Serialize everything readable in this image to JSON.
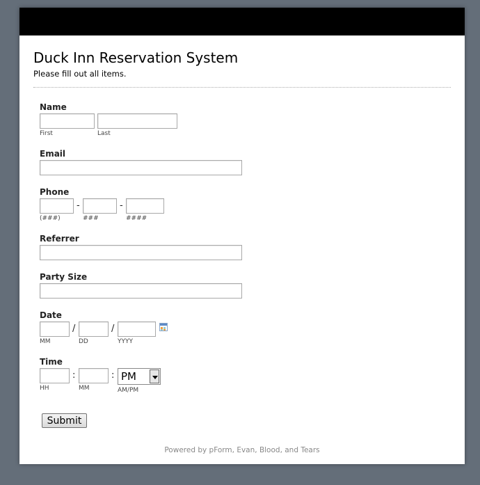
{
  "header": {
    "title": "Duck Inn Reservation System",
    "subtitle": "Please fill out all items."
  },
  "form": {
    "name": {
      "label": "Name",
      "first_hint": "First",
      "last_hint": "Last",
      "first_value": "",
      "last_value": ""
    },
    "email": {
      "label": "Email",
      "value": ""
    },
    "phone": {
      "label": "Phone",
      "hint1": "(###)",
      "hint2": "###",
      "hint3": "####",
      "sep": "-"
    },
    "referrer": {
      "label": "Referrer",
      "value": ""
    },
    "party_size": {
      "label": "Party Size",
      "value": ""
    },
    "date": {
      "label": "Date",
      "hint_mm": "MM",
      "hint_dd": "DD",
      "hint_yyyy": "YYYY",
      "sep": "/"
    },
    "time": {
      "label": "Time",
      "hint_hh": "HH",
      "hint_mm": "MM",
      "hint_ampm": "AM/PM",
      "sep": ":",
      "ampm_selected": "PM"
    },
    "submit_label": "Submit"
  },
  "footer": {
    "text": "Powered by pForm, Evan, Blood, and Tears"
  },
  "colors": {
    "background": "#646e79",
    "topbar": "#000000",
    "panel": "#ffffff"
  },
  "icons": {
    "calendar": "calendar-icon",
    "dropdown": "chevron-down-icon"
  }
}
